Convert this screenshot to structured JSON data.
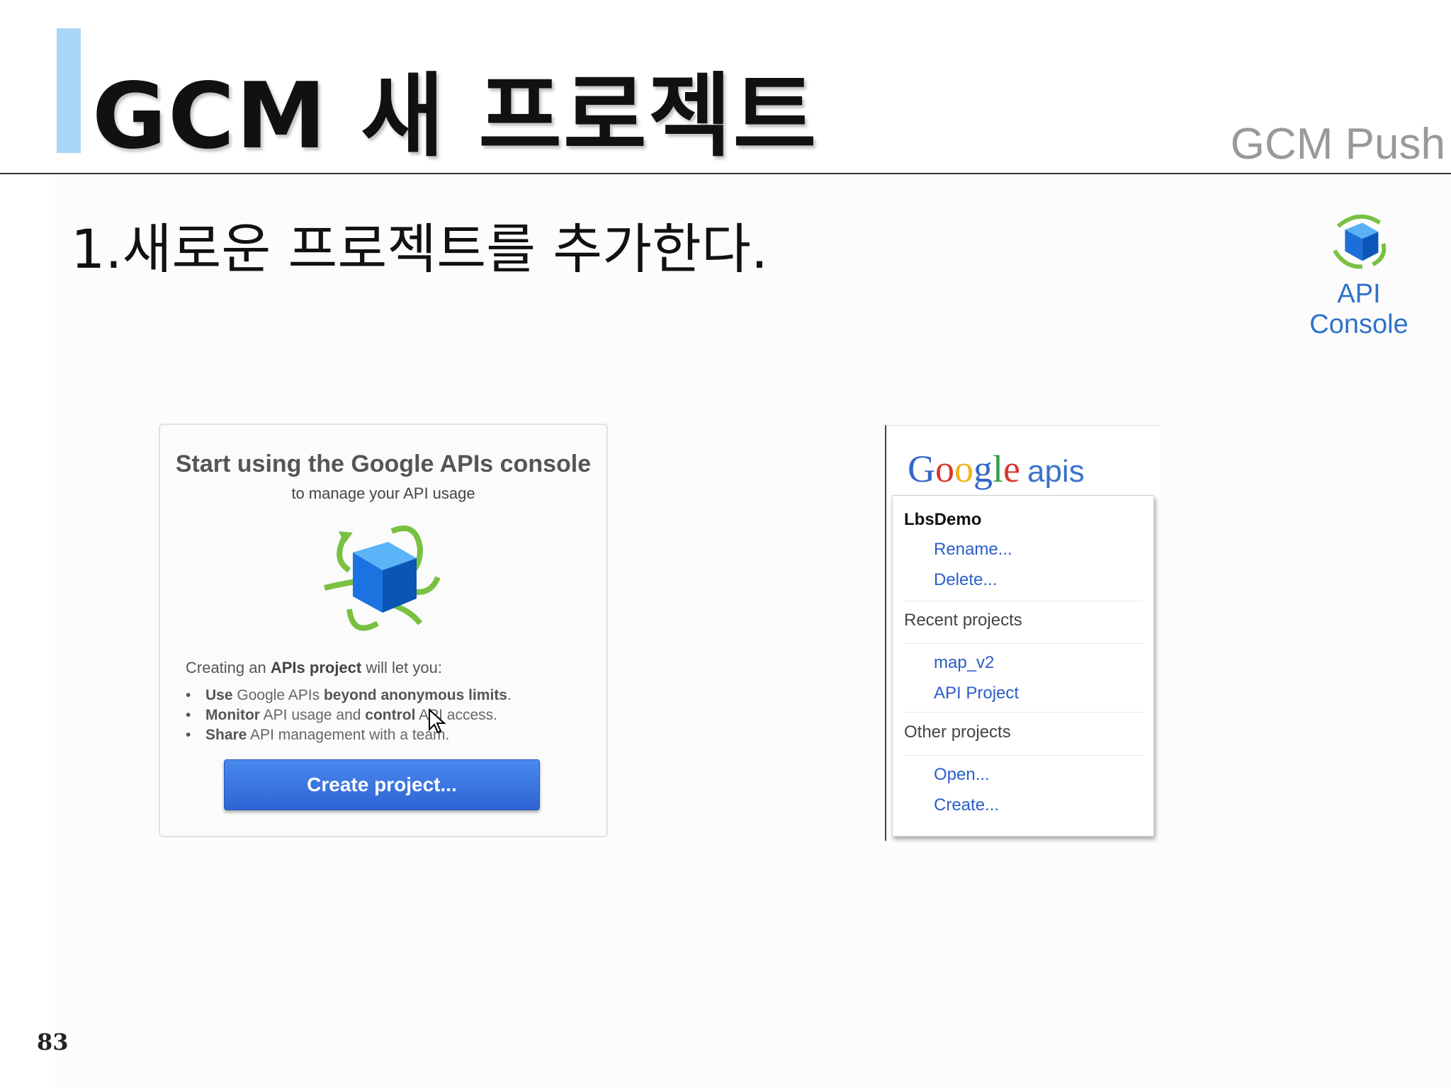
{
  "slide": {
    "title": "GCM 새 프로젝트",
    "section_label": "GCM Push",
    "step_text": "1.새로운 프로젝트를 추가한다.",
    "logo_label": "API Console",
    "page_number": "83"
  },
  "start_panel": {
    "heading": "Start using the Google APIs console",
    "subheading": "to manage your API usage",
    "intro_prefix": "Creating an ",
    "intro_bold": "APIs project",
    "intro_suffix": " will let you:",
    "benefits": [
      {
        "bold1": "Use",
        "text1": " Google APIs ",
        "bold2": "beyond anonymous limits",
        "text2": "."
      },
      {
        "bold1": "Monitor",
        "text1": " API usage and ",
        "bold2": "control",
        "text2": " API access."
      },
      {
        "bold1": "Share",
        "text1": " API management with a team.",
        "bold2": "",
        "text2": ""
      }
    ],
    "create_button": "Create project..."
  },
  "project_panel": {
    "logo_letters": [
      "G",
      "o",
      "o",
      "g",
      "l",
      "e"
    ],
    "logo_suffix": "apis",
    "current_project": "LbsDemo",
    "rename": "Rename...",
    "delete": "Delete...",
    "recent_label": "Recent projects",
    "recent": [
      "map_v2",
      "API Project"
    ],
    "other_label": "Other projects",
    "open": "Open...",
    "create": "Create..."
  },
  "colors": {
    "title_accent": "#a9d5f7",
    "link_blue": "#2a5ec9",
    "button_blue": "#3b74e0",
    "cube_blue": "#1f7be0",
    "arrow_green": "#7ac142"
  }
}
